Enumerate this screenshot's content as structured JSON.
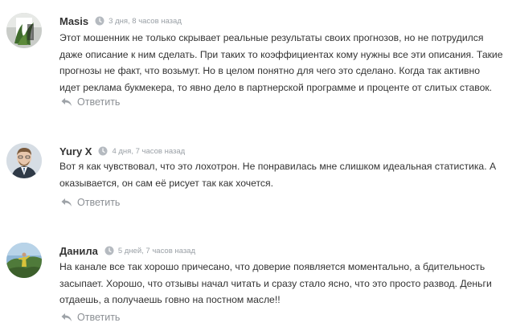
{
  "comments": [
    {
      "author": "Masis",
      "time": "3 дня, 8 часов назад",
      "text": "Этот мошенник не только скрывает реальные результаты своих прогнозов, но не потрудился даже описание к ним сделать. При таких то коэффициентах кому нужны все эти описания. Такие прогнозы не факт, что возьмут. Но в целом понятно для чего это сделано. Когда так активно идет реклама букмекера, то явно дело в партнерской программе и проценте от слитых ставок.",
      "reply_label": "Ответить",
      "avatar_icon": "avatar-plant-photo"
    },
    {
      "author": "Yury X",
      "time": "4 дня, 7 часов назад",
      "text": "Вот я как чувствовал, что это лохотрон. Не понравилась мне слишком идеальная статистика. А оказывается, он сам её рисует так как хочется.",
      "reply_label": "Ответить",
      "avatar_icon": "avatar-man-photo"
    },
    {
      "author": "Данила",
      "time": "5 дней, 7 часов назад",
      "text": "На канале все так хорошо причесано, что доверие появляется моментально, а бдительность засыпает. Хорошо, что отзывы начал читать и сразу стало ясно, что это просто развод. Деньги отдаешь, а получаешь говно на постном масле!!",
      "reply_label": "Ответить",
      "avatar_icon": "avatar-landscape-photo"
    }
  ],
  "colors": {
    "text": "#333333",
    "meta": "#9aa0a6",
    "reply": "#8b8f94"
  }
}
